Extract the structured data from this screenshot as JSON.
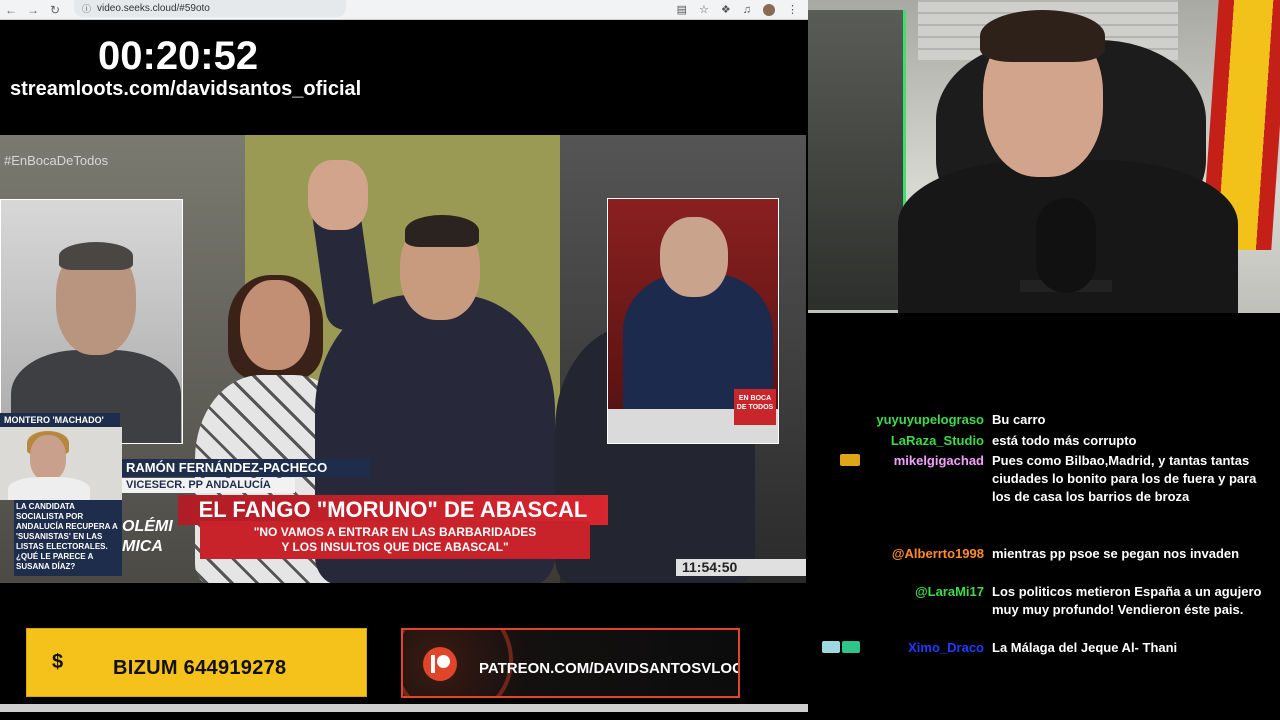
{
  "browser": {
    "url": "video.seeks.cloud/#59oto"
  },
  "overlay": {
    "timer": "00:20:52",
    "streamloots": "streamloots.com/davidsantos_oficial"
  },
  "tv": {
    "hashtag": "#EnBocaDeTodos",
    "name_plate": "RAMÓN FERNÁNDEZ-PACHECO",
    "role_plate": "VICESECR. PP ANDALUCÍA",
    "headline": "EL FANGO \"MORUNO\" DE ABASCAL",
    "subline_1": "\"NO VAMOS A ENTRAR EN LAS BARBARIDADES",
    "subline_2": "Y LOS INSULTOS QUE DICE ABASCAL\"",
    "clock": "11:54:50",
    "montero_label": "MONTERO 'MACHADO'",
    "question": "LA CANDIDATA SOCIALISTA POR ANDALUCÍA RECUPERA A 'SUSANISTAS' EN LAS LISTAS ELECTORALES. ¿QUÉ LE PARECE A SUSANA DÍAZ?",
    "edge_text_1": "OLÉMI",
    "edge_text_2": "MICA",
    "channel_logo": "EN BOCA DE TODOS"
  },
  "donations": {
    "bizum_icon": "$",
    "bizum_text": "BIZUM 644919278",
    "patreon_text": "PATREON.COM/DAVIDSANTOSVLOG"
  },
  "chat": {
    "messages": [
      {
        "user": "yuyuyupelograso",
        "color": "#3ddc4a",
        "text": "Bu carro",
        "badges": []
      },
      {
        "user": "LaRaza_Studio",
        "color": "#3ddc4a",
        "text": "está todo más corrupto",
        "badges": []
      },
      {
        "user": "mikelgigachad",
        "color": "#f4a0ff",
        "text": "Pues como Bilbao,Madrid, y tantas tantas ciudades lo bonito para los de fuera y para los de casa los barrios de broza",
        "badges": [
          "gold-badge"
        ]
      },
      {
        "user": "@Alberrto1998",
        "color": "#ff8c2a",
        "text": "mientras pp psoe se pegan nos invaden",
        "badges": []
      },
      {
        "user": "@LaraMi17",
        "color": "#3ddc4a",
        "text": "Los politicos metieron España a un agujero muy muy profundo! Vendieron éste pais.",
        "badges": []
      },
      {
        "user": "Ximo_Draco",
        "color": "#1e3cff",
        "text": "La Málaga del Jeque Al- Thani",
        "badges": [
          "diamond-badge",
          "green-badge"
        ]
      }
    ]
  }
}
